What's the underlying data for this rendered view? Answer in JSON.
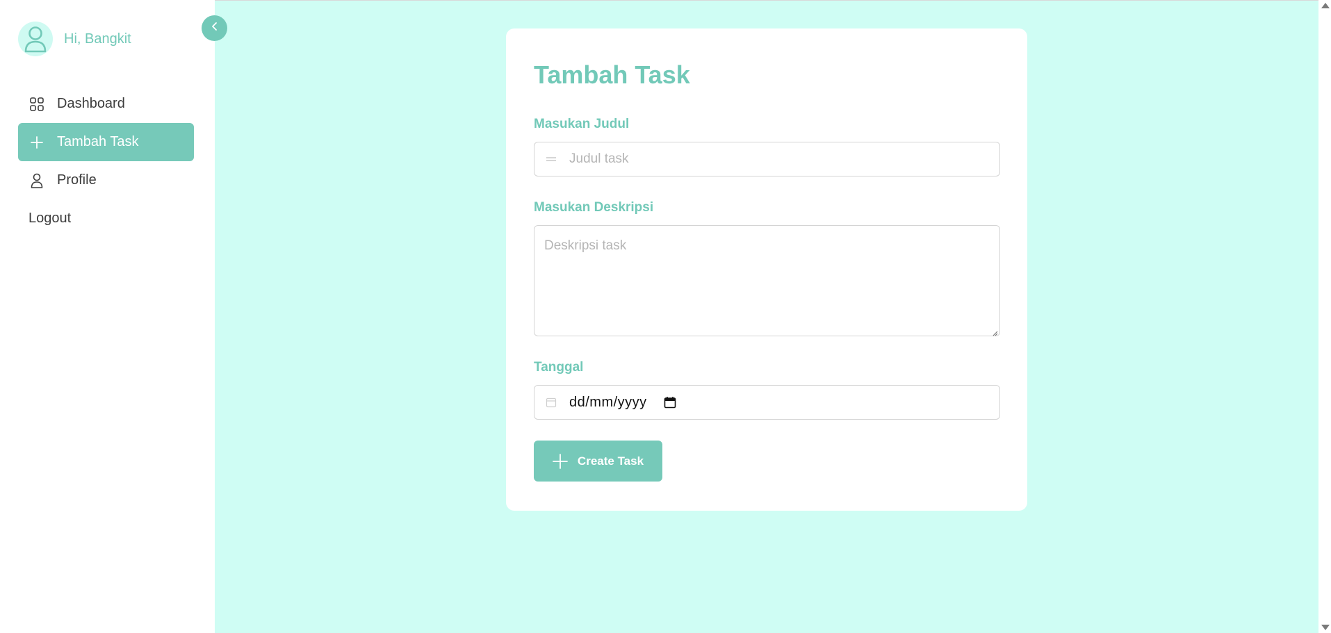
{
  "user": {
    "greeting": "Hi, Bangkit"
  },
  "sidebar": {
    "items": [
      {
        "label": "Dashboard",
        "icon": "grid-icon"
      },
      {
        "label": "Tambah Task",
        "icon": "plus-icon",
        "active": true
      },
      {
        "label": "Profile",
        "icon": "user-icon"
      },
      {
        "label": "Logout"
      }
    ]
  },
  "form": {
    "title": "Tambah Task",
    "title_label": "Masukan Judul",
    "title_placeholder": "Judul task",
    "desc_label": "Masukan Deskripsi",
    "desc_placeholder": "Deskripsi task",
    "date_label": "Tanggal",
    "date_value": "dd/mm/yyyy",
    "submit_label": "Create Task"
  },
  "colors": {
    "accent": "#76c9b9",
    "background": "#cffdf4",
    "text_accent": "#72c9b8"
  }
}
